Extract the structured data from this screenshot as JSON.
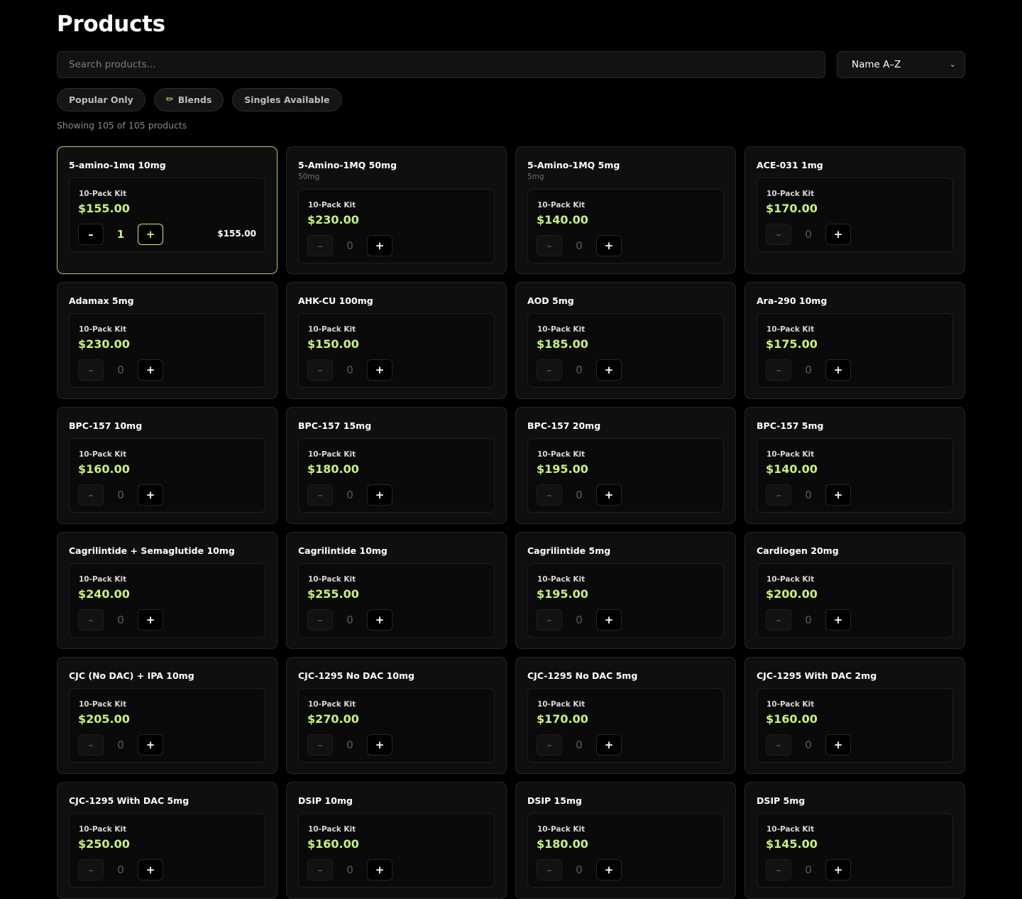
{
  "page": {
    "title": "Products"
  },
  "search": {
    "placeholder": "Search products..."
  },
  "sort": {
    "selected": "Name A–Z"
  },
  "filters": [
    {
      "label": "Popular Only",
      "icon": ""
    },
    {
      "label": "Blends",
      "icon": "pencil-icon"
    },
    {
      "label": "Singles Available",
      "icon": ""
    }
  ],
  "count_text": "Showing 105 of 105 products",
  "colors": {
    "accent": "#c8f27a",
    "background": "#000000",
    "card": "#0f0f0f"
  },
  "products": [
    {
      "name": "5-amino-1mq 10mg",
      "sub": "",
      "kit": "10-Pack Kit",
      "price": "$155.00",
      "qty": "1",
      "line_total": "$155.00",
      "selected": true
    },
    {
      "name": "5-Amino-1MQ 50mg",
      "sub": "50mg",
      "kit": "10-Pack Kit",
      "price": "$230.00",
      "qty": "0",
      "line_total": "",
      "selected": false
    },
    {
      "name": "5-Amino-1MQ 5mg",
      "sub": "5mg",
      "kit": "10-Pack Kit",
      "price": "$140.00",
      "qty": "0",
      "line_total": "",
      "selected": false
    },
    {
      "name": "ACE-031 1mg",
      "sub": "",
      "kit": "10-Pack Kit",
      "price": "$170.00",
      "qty": "0",
      "line_total": "",
      "selected": false
    },
    {
      "name": "Adamax 5mg",
      "sub": "",
      "kit": "10-Pack Kit",
      "price": "$230.00",
      "qty": "0",
      "line_total": "",
      "selected": false
    },
    {
      "name": "AHK-CU 100mg",
      "sub": "",
      "kit": "10-Pack Kit",
      "price": "$150.00",
      "qty": "0",
      "line_total": "",
      "selected": false
    },
    {
      "name": "AOD 5mg",
      "sub": "",
      "kit": "10-Pack Kit",
      "price": "$185.00",
      "qty": "0",
      "line_total": "",
      "selected": false
    },
    {
      "name": "Ara-290 10mg",
      "sub": "",
      "kit": "10-Pack Kit",
      "price": "$175.00",
      "qty": "0",
      "line_total": "",
      "selected": false
    },
    {
      "name": "BPC-157 10mg",
      "sub": "",
      "kit": "10-Pack Kit",
      "price": "$160.00",
      "qty": "0",
      "line_total": "",
      "selected": false
    },
    {
      "name": "BPC-157 15mg",
      "sub": "",
      "kit": "10-Pack Kit",
      "price": "$180.00",
      "qty": "0",
      "line_total": "",
      "selected": false
    },
    {
      "name": "BPC-157 20mg",
      "sub": "",
      "kit": "10-Pack Kit",
      "price": "$195.00",
      "qty": "0",
      "line_total": "",
      "selected": false
    },
    {
      "name": "BPC-157 5mg",
      "sub": "",
      "kit": "10-Pack Kit",
      "price": "$140.00",
      "qty": "0",
      "line_total": "",
      "selected": false
    },
    {
      "name": "Cagrilintide + Semaglutide 10mg",
      "sub": "",
      "kit": "10-Pack Kit",
      "price": "$240.00",
      "qty": "0",
      "line_total": "",
      "selected": false
    },
    {
      "name": "Cagrilintide 10mg",
      "sub": "",
      "kit": "10-Pack Kit",
      "price": "$255.00",
      "qty": "0",
      "line_total": "",
      "selected": false
    },
    {
      "name": "Cagrilintide 5mg",
      "sub": "",
      "kit": "10-Pack Kit",
      "price": "$195.00",
      "qty": "0",
      "line_total": "",
      "selected": false
    },
    {
      "name": "Cardiogen 20mg",
      "sub": "",
      "kit": "10-Pack Kit",
      "price": "$200.00",
      "qty": "0",
      "line_total": "",
      "selected": false
    },
    {
      "name": "CJC (No DAC) + IPA 10mg",
      "sub": "",
      "kit": "10-Pack Kit",
      "price": "$205.00",
      "qty": "0",
      "line_total": "",
      "selected": false
    },
    {
      "name": "CJC-1295 No DAC 10mg",
      "sub": "",
      "kit": "10-Pack Kit",
      "price": "$270.00",
      "qty": "0",
      "line_total": "",
      "selected": false
    },
    {
      "name": "CJC-1295 No DAC 5mg",
      "sub": "",
      "kit": "10-Pack Kit",
      "price": "$170.00",
      "qty": "0",
      "line_total": "",
      "selected": false
    },
    {
      "name": "CJC-1295 With DAC 2mg",
      "sub": "",
      "kit": "10-Pack Kit",
      "price": "$160.00",
      "qty": "0",
      "line_total": "",
      "selected": false
    },
    {
      "name": "CJC-1295 With DAC 5mg",
      "sub": "",
      "kit": "10-Pack Kit",
      "price": "$250.00",
      "qty": "0",
      "line_total": "",
      "selected": false
    },
    {
      "name": "DSIP 10mg",
      "sub": "",
      "kit": "10-Pack Kit",
      "price": "$160.00",
      "qty": "0",
      "line_total": "",
      "selected": false
    },
    {
      "name": "DSIP 15mg",
      "sub": "",
      "kit": "10-Pack Kit",
      "price": "$180.00",
      "qty": "0",
      "line_total": "",
      "selected": false
    },
    {
      "name": "DSIP 5mg",
      "sub": "",
      "kit": "10-Pack Kit",
      "price": "$145.00",
      "qty": "0",
      "line_total": "",
      "selected": false
    }
  ]
}
